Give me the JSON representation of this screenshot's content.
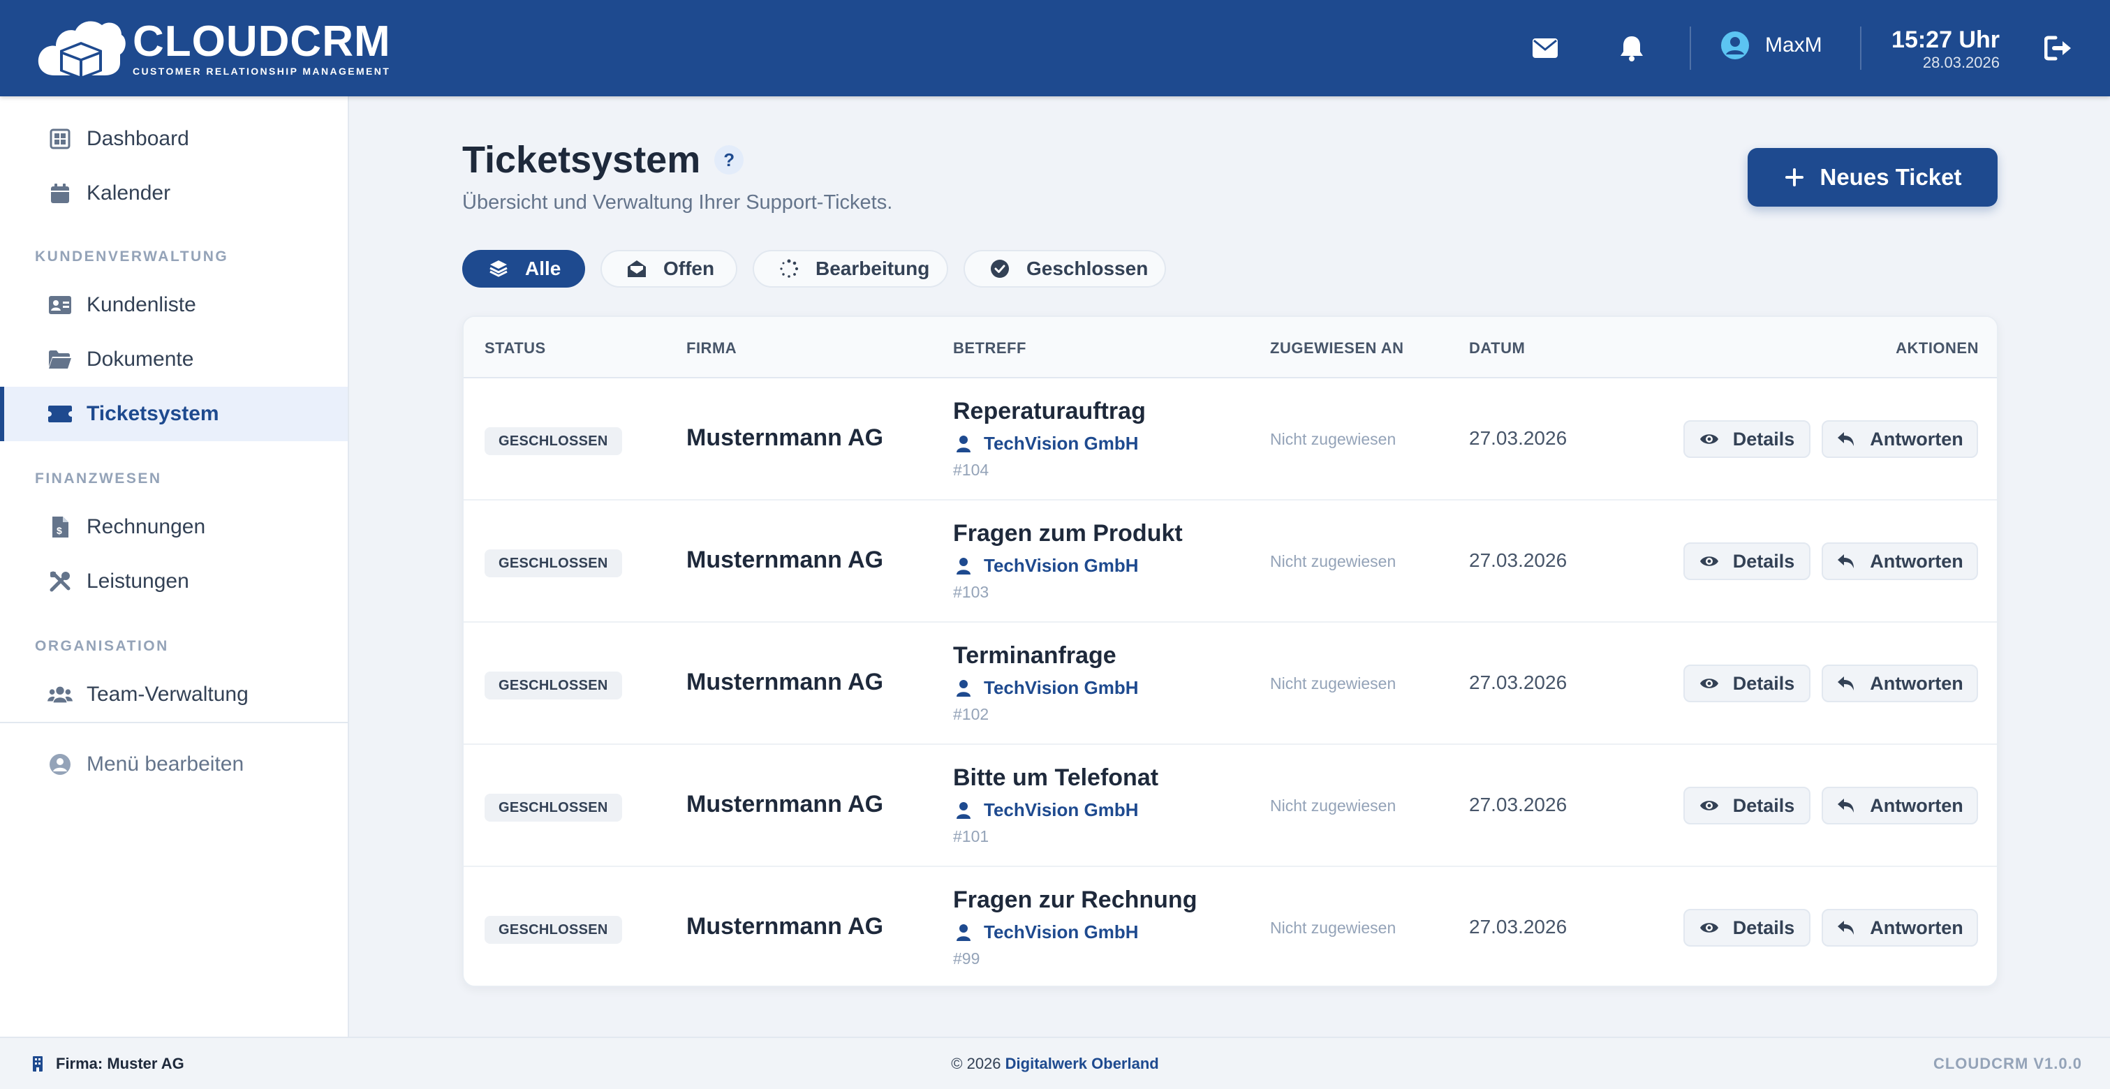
{
  "app": {
    "name": "CLOUDCRM",
    "tagline": "CUSTOMER RELATIONSHIP MANAGEMENT"
  },
  "header": {
    "user_name": "MaxM",
    "time": "15:27 Uhr",
    "date": "28.03.2026",
    "icons": [
      "envelope-icon",
      "bell-icon",
      "user-circle-icon",
      "logout-icon"
    ]
  },
  "sidebar": {
    "top_items": [
      {
        "label": "Dashboard",
        "icon": "dashboard-icon"
      },
      {
        "label": "Kalender",
        "icon": "calendar-icon"
      }
    ],
    "sections": [
      {
        "title": "KUNDENVERWALTUNG",
        "items": [
          {
            "label": "Kundenliste",
            "icon": "address-card-icon"
          },
          {
            "label": "Dokumente",
            "icon": "folder-icon"
          },
          {
            "label": "Ticketsystem",
            "icon": "ticket-icon",
            "active": true
          }
        ]
      },
      {
        "title": "FINANZWESEN",
        "items": [
          {
            "label": "Rechnungen",
            "icon": "invoice-icon"
          },
          {
            "label": "Leistungen",
            "icon": "tools-icon"
          }
        ]
      },
      {
        "title": "ORGANISATION",
        "items": [
          {
            "label": "Team-Verwaltung",
            "icon": "team-icon"
          }
        ]
      }
    ],
    "edit_menu": "Menü bearbeiten"
  },
  "page": {
    "title": "Ticketsystem",
    "help": "?",
    "subtitle": "Übersicht und Verwaltung Ihrer Support-Tickets.",
    "new_button": "Neues Ticket"
  },
  "filters": [
    {
      "label": "Alle",
      "icon": "layers-icon",
      "active": true
    },
    {
      "label": "Offen",
      "icon": "envelope-open-icon"
    },
    {
      "label": "Bearbeitung",
      "icon": "spinner-icon"
    },
    {
      "label": "Geschlossen",
      "icon": "check-circle-icon"
    }
  ],
  "table": {
    "columns": [
      "STATUS",
      "FIRMA",
      "BETREFF",
      "ZUGEWIESEN AN",
      "DATUM",
      "AKTIONEN"
    ],
    "rows": [
      {
        "status": "GESCHLOSSEN",
        "firm": "Musternmann AG",
        "subject": "Reperaturauftrag",
        "customer": "TechVision GmbH",
        "number": "#104",
        "assignee": "Nicht zugewiesen",
        "date": "27.03.2026"
      },
      {
        "status": "GESCHLOSSEN",
        "firm": "Musternmann AG",
        "subject": "Fragen zum Produkt",
        "customer": "TechVision GmbH",
        "number": "#103",
        "assignee": "Nicht zugewiesen",
        "date": "27.03.2026"
      },
      {
        "status": "GESCHLOSSEN",
        "firm": "Musternmann AG",
        "subject": "Terminanfrage",
        "customer": "TechVision GmbH",
        "number": "#102",
        "assignee": "Nicht zugewiesen",
        "date": "27.03.2026"
      },
      {
        "status": "GESCHLOSSEN",
        "firm": "Musternmann AG",
        "subject": "Bitte um Telefonat",
        "customer": "TechVision GmbH",
        "number": "#101",
        "assignee": "Nicht zugewiesen",
        "date": "27.03.2026"
      },
      {
        "status": "GESCHLOSSEN",
        "firm": "Musternmann AG",
        "subject": "Fragen zur Rechnung",
        "customer": "TechVision GmbH",
        "number": "#99",
        "assignee": "Nicht zugewiesen",
        "date": "27.03.2026"
      }
    ],
    "details_label": "Details",
    "reply_label": "Antworten"
  },
  "footer": {
    "firm": "Firma: Muster AG",
    "copyright": "© 2026 ",
    "brand": "Digitalwerk Oberland",
    "version": "CLOUDCRM V1.0.0"
  },
  "colors": {
    "primary": "#1e4a8f",
    "background": "#f0f3f8",
    "muted_text": "#94a3b8"
  }
}
